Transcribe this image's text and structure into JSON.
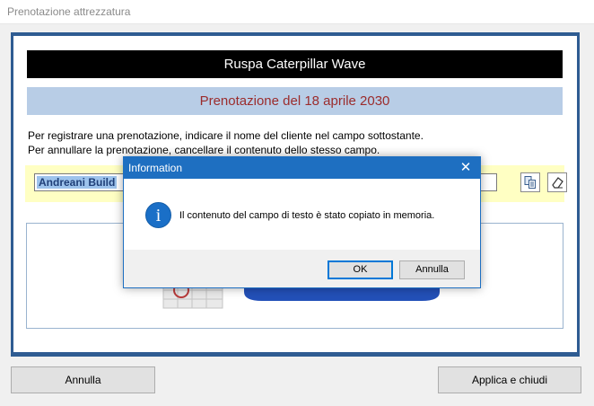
{
  "window": {
    "title": "Prenotazione attrezzatura"
  },
  "header": {
    "equipment_name": "Ruspa Caterpillar Wave",
    "booking_date_title": "Prenotazione del 18 aprile 2030"
  },
  "instructions": [
    "Per registrare una prenotazione, indicare il nome del cliente nel campo sottostante.",
    "Per annullare la prenotazione, cancellare il contenuto dello stesso campo."
  ],
  "client_field": {
    "value": "Andreani Build"
  },
  "icons": {
    "copy": "copy-icon",
    "eraser": "eraser-icon",
    "info": "info-icon",
    "close": "close-icon"
  },
  "footer": {
    "cancel_label": "Annulla",
    "apply_label": "Applica e chiudi"
  },
  "dialog": {
    "title": "Information",
    "message": "Il contenuto del campo di testo è stato copiato in memoria.",
    "ok_label": "OK",
    "cancel_label": "Annulla",
    "close_glyph": "✕",
    "icon_glyph": "i"
  },
  "colors": {
    "accent": "#1e6fc1",
    "frame": "#2f5c92",
    "header_dark": "#000000",
    "header_light": "#b8cde6",
    "date_text": "#9b2c2c",
    "highlight": "#ffffc3"
  }
}
